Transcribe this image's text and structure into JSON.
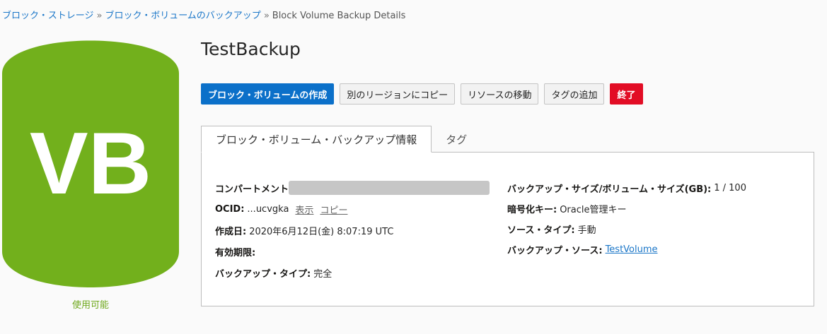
{
  "breadcrumb": {
    "item1": "ブロック・ストレージ",
    "item2": "ブロック・ボリュームのバックアップ",
    "current": "Block Volume Backup Details",
    "separator": "»"
  },
  "badge": {
    "initials": "VB",
    "status": "使用可能",
    "color": "#72b01c"
  },
  "title": "TestBackup",
  "actions": {
    "create": "ブロック・ボリュームの作成",
    "copy_region": "別のリージョンにコピー",
    "move": "リソースの移動",
    "add_tag": "タグの追加",
    "terminate": "終了"
  },
  "tabs": {
    "info": "ブロック・ボリューム・バックアップ情報",
    "tags": "タグ"
  },
  "details": {
    "compartment_label": "コンパートメント",
    "ocid_label": "OCID:",
    "ocid_value": "...ucvgka",
    "ocid_show": "表示",
    "ocid_copy": "コピー",
    "created_label": "作成日:",
    "created_value": "2020年6月12日(金) 8:07:19 UTC",
    "expiry_label": "有効期限:",
    "backup_type_label": "バックアップ・タイプ:",
    "backup_type_value": "完全",
    "size_label": "バックアップ・サイズ/ボリューム・サイズ(GB):",
    "size_value": "1 / 100",
    "encryption_label": "暗号化キー:",
    "encryption_value": "Oracle管理キー",
    "source_type_label": "ソース・タイプ:",
    "source_type_value": "手動",
    "backup_source_label": "バックアップ・ソース:",
    "backup_source_value": "TestVolume"
  }
}
